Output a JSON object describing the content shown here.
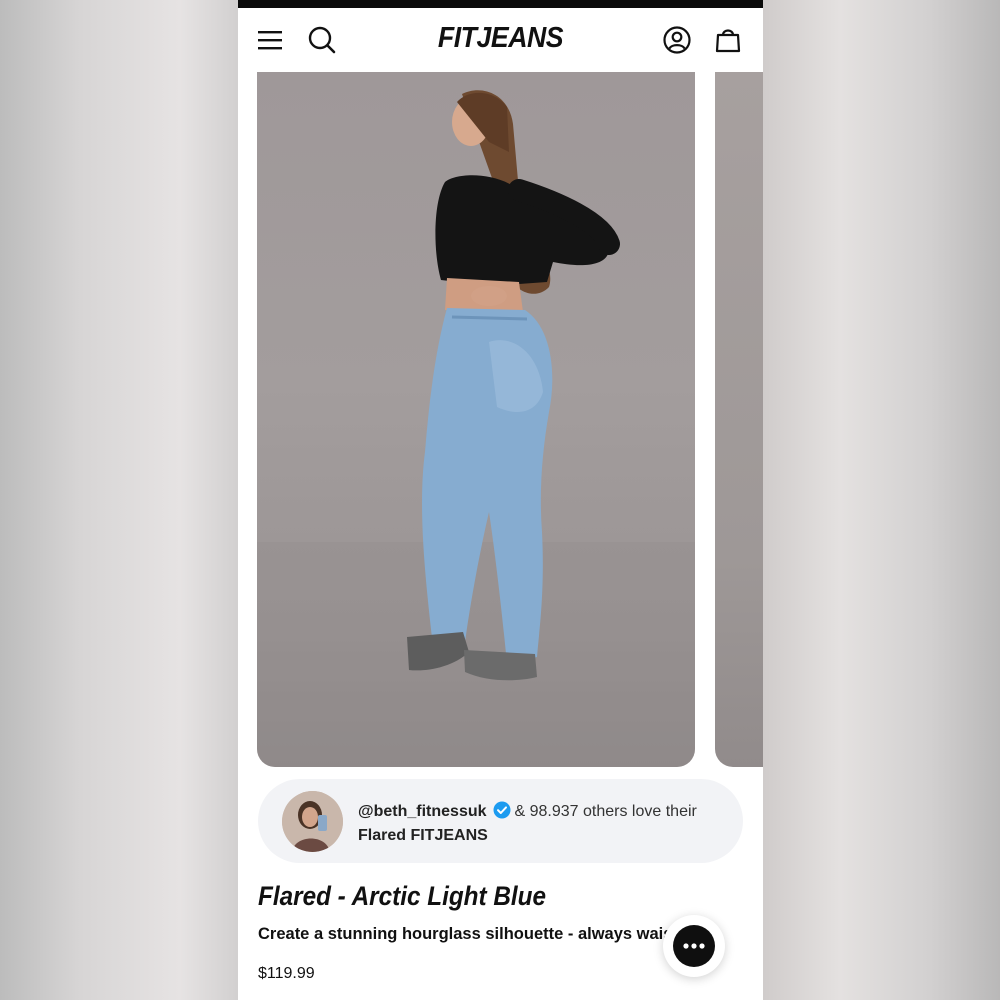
{
  "header": {
    "brand": "FITJEANS",
    "menu_icon": "hamburger-menu-icon",
    "search_icon": "search-icon",
    "account_icon": "account-icon",
    "cart_icon": "shopping-bag-icon"
  },
  "social_proof": {
    "handle": "@beth_fitnessuk",
    "verified_icon": "verified-badge-icon",
    "others_text": "& 98.937 others love their",
    "product_name": "Flared FITJEANS"
  },
  "product": {
    "title": "Flared - Arctic Light Blue",
    "description": "Create a stunning hourglass silhouette - always waist gap free.",
    "price": "$119.99"
  },
  "chat": {
    "icon": "chat-bubble-icon"
  },
  "colors": {
    "text": "#111111",
    "pill_bg": "#f2f3f6",
    "verified_blue": "#1d9bf0",
    "photo_bg": "#a39d9d"
  }
}
